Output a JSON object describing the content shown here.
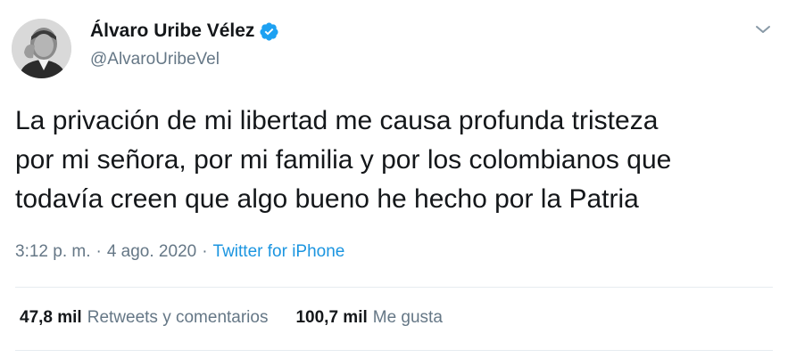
{
  "user": {
    "display_name": "Álvaro Uribe Vélez",
    "handle": "@AlvaroUribeVel",
    "verified": true
  },
  "tweet": {
    "text": "La privación de mi libertad me causa profunda tristeza\npor mi señora, por mi familia y por los colombianos que\ntodavía creen que algo bueno he hecho por la Patria"
  },
  "meta": {
    "time": "3:12 p. m.",
    "separator": "·",
    "date": "4 ago. 2020",
    "source": "Twitter for iPhone"
  },
  "stats": {
    "retweets_count": "47,8 mil",
    "retweets_label": "Retweets y comentarios",
    "likes_count": "100,7 mil",
    "likes_label": "Me gusta"
  },
  "colors": {
    "text": "#14171a",
    "secondary": "#657786",
    "link": "#1b95e0",
    "verified": "#1da1f2",
    "divider": "#e6ecf0"
  },
  "icons": {
    "verified": "verified-badge-icon",
    "menu": "chevron-down-icon"
  }
}
